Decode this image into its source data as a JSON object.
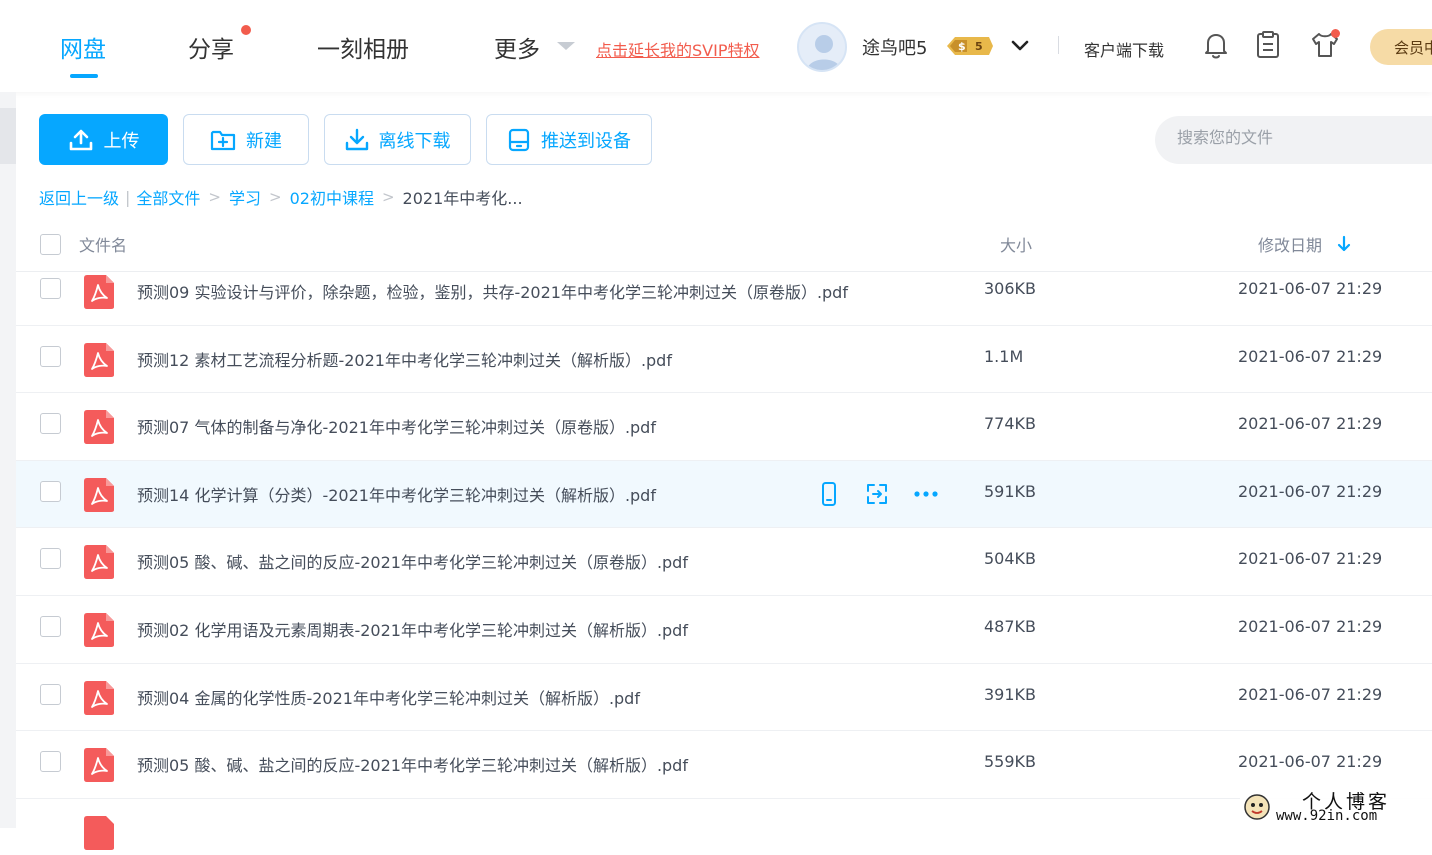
{
  "nav": {
    "tabs": [
      {
        "label": "网盘",
        "active": true
      },
      {
        "label": "分享",
        "badge": true
      },
      {
        "label": "一刻相册"
      },
      {
        "label": "更多"
      }
    ],
    "svip_link": "点击延长我的SVIP特权",
    "username": "途鸟吧5",
    "vip_level": "5",
    "client_download": "客户端下载",
    "member_button": "会员中心",
    "icons": [
      "bell-icon",
      "clipboard-icon",
      "shirt-icon"
    ]
  },
  "toolbar": {
    "upload": "上传",
    "new": "新建",
    "offline_download": "离线下载",
    "push_to_device": "推送到设备",
    "search_placeholder": "搜索您的文件"
  },
  "breadcrumb": {
    "back": "返回上一级",
    "items": [
      "全部文件",
      "学习",
      "02初中课程"
    ],
    "current": "2021年中考化..."
  },
  "table": {
    "headers": {
      "name": "文件名",
      "size": "大小",
      "modified": "修改日期"
    },
    "sort": "modified-desc",
    "rows": [
      {
        "name": "预测09 实验设计与评价，除杂题，检验，鉴别，共存-2021年中考化学三轮冲刺过关（原卷版）.pdf",
        "size": "306KB",
        "date": "2021-06-07 21:29"
      },
      {
        "name": "预测12 素材工艺流程分析题-2021年中考化学三轮冲刺过关（解析版）.pdf",
        "size": "1.1M",
        "date": "2021-06-07 21:29"
      },
      {
        "name": "预测07 气体的制备与净化-2021年中考化学三轮冲刺过关（原卷版）.pdf",
        "size": "774KB",
        "date": "2021-06-07 21:29"
      },
      {
        "name": "预测14 化学计算（分类）-2021年中考化学三轮冲刺过关（解析版）.pdf",
        "size": "591KB",
        "date": "2021-06-07 21:29",
        "hover": true
      },
      {
        "name": "预测05 酸、碱、盐之间的反应-2021年中考化学三轮冲刺过关（原卷版）.pdf",
        "size": "504KB",
        "date": "2021-06-07 21:29"
      },
      {
        "name": "预测02 化学用语及元素周期表-2021年中考化学三轮冲刺过关（解析版）.pdf",
        "size": "487KB",
        "date": "2021-06-07 21:29"
      },
      {
        "name": "预测04 金属的化学性质-2021年中考化学三轮冲刺过关（解析版）.pdf",
        "size": "391KB",
        "date": "2021-06-07 21:29"
      },
      {
        "name": "预测05 酸、碱、盐之间的反应-2021年中考化学三轮冲刺过关（解析版）.pdf",
        "size": "559KB",
        "date": "2021-06-07 21:29"
      }
    ]
  },
  "watermark": {
    "title": "个人博客",
    "url": "www.92in.com"
  },
  "colors": {
    "accent": "#06a7ff",
    "danger": "#f25c4d",
    "pdf": "#f45b5b",
    "hover_row": "#f1f9fe"
  }
}
